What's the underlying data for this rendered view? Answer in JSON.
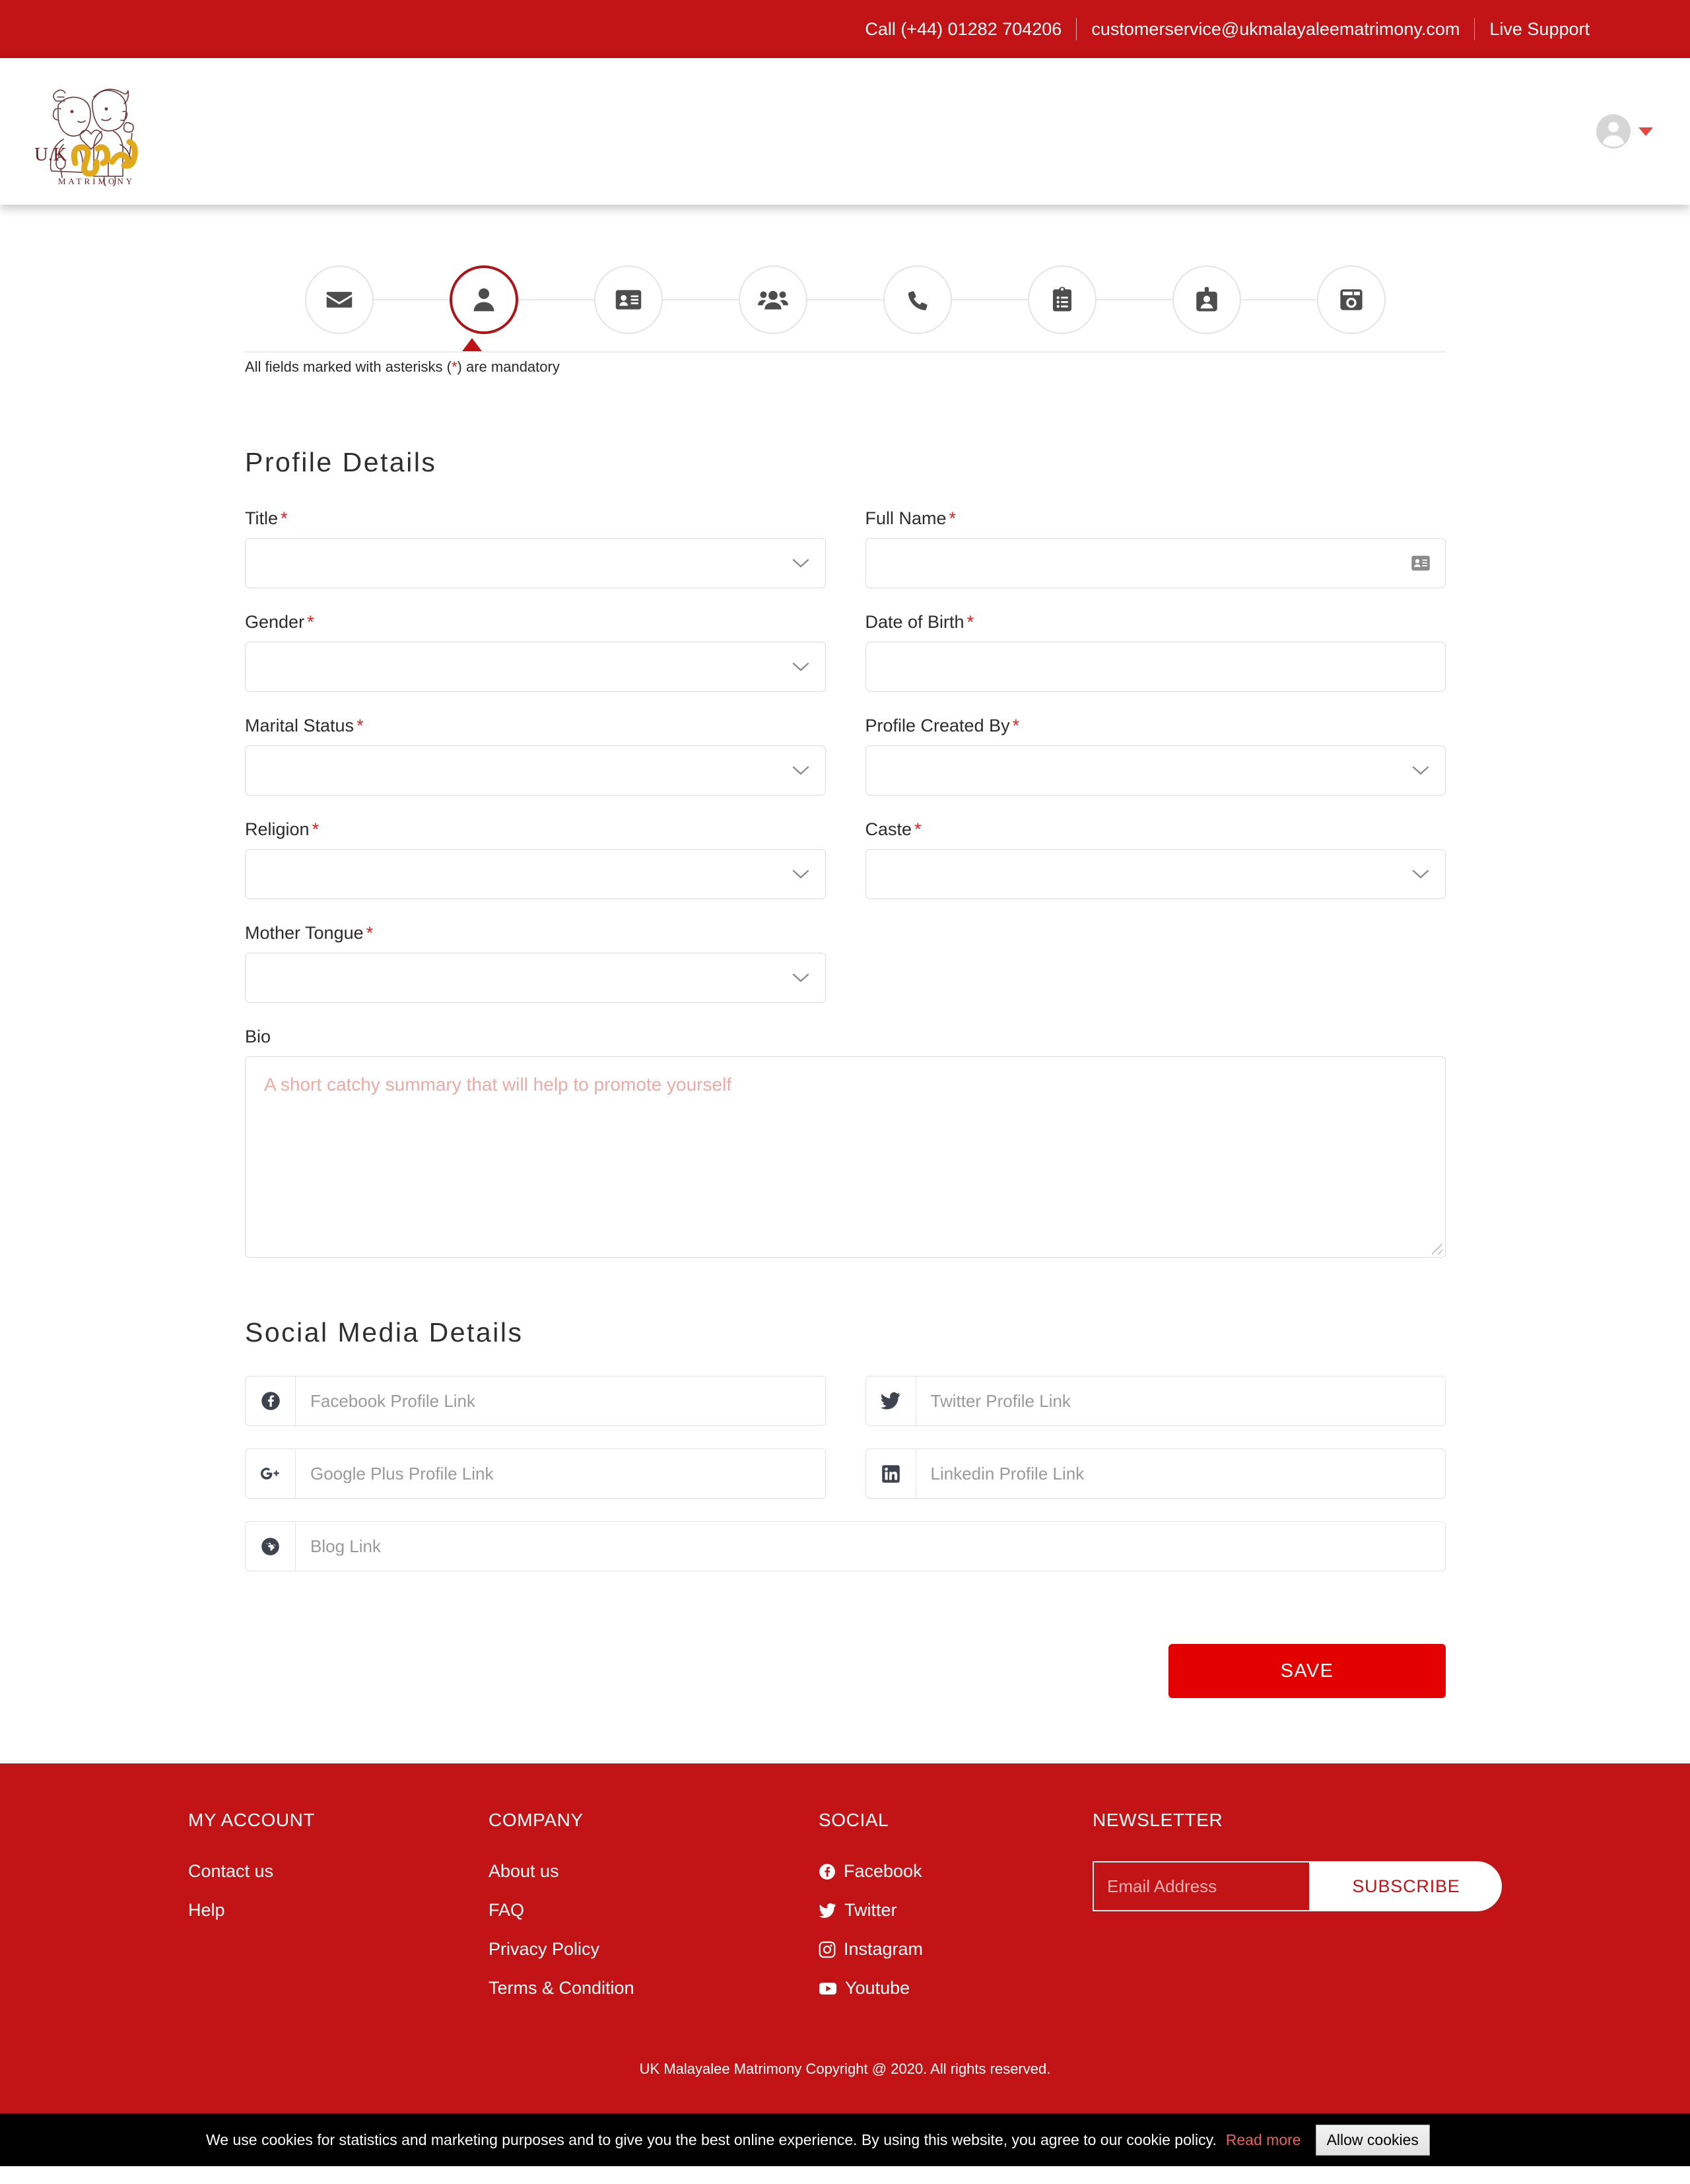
{
  "topbar": {
    "phone": "Call (+44) 01282 704206",
    "email": "customerservice@ukmalayaleematrimony.com",
    "support": "Live Support"
  },
  "header": {
    "logo_text_uk": "U.K",
    "logo_text_matrimony": "MATRIMONY",
    "account_icon": "user-avatar-icon",
    "caret_icon": "caret-down-icon"
  },
  "stepper": {
    "steps": [
      {
        "icon": "envelope-icon",
        "active": false
      },
      {
        "icon": "user-icon",
        "active": true
      },
      {
        "icon": "id-card-icon",
        "active": false
      },
      {
        "icon": "users-group-icon",
        "active": false
      },
      {
        "icon": "phone-icon",
        "active": false
      },
      {
        "icon": "clipboard-list-icon",
        "active": false
      },
      {
        "icon": "id-badge-icon",
        "active": false
      },
      {
        "icon": "camera-icon",
        "active": false
      }
    ],
    "note_before": "All fields marked with asterisks (",
    "note_asterisk": "*",
    "note_after": ") are mandatory"
  },
  "profile_section": {
    "title": "Profile Details",
    "fields": [
      {
        "label": "Title",
        "required": true,
        "type": "select",
        "value": "",
        "name": "title"
      },
      {
        "label": "Full Name",
        "required": true,
        "type": "text",
        "value": "",
        "placeholder": "",
        "name": "full-name",
        "trail_icon": "contact-card-icon"
      },
      {
        "label": "Gender",
        "required": true,
        "type": "select",
        "value": "",
        "name": "gender"
      },
      {
        "label": "Date of Birth",
        "required": true,
        "type": "text",
        "value": "",
        "placeholder": "",
        "name": "date-of-birth"
      },
      {
        "label": "Marital Status",
        "required": true,
        "type": "select",
        "value": "",
        "name": "marital-status"
      },
      {
        "label": "Profile Created By",
        "required": true,
        "type": "select",
        "value": "",
        "name": "profile-created-by"
      },
      {
        "label": "Religion",
        "required": true,
        "type": "select",
        "value": "",
        "name": "religion"
      },
      {
        "label": "Caste",
        "required": true,
        "type": "select",
        "value": "",
        "name": "caste"
      },
      {
        "label": "Mother Tongue",
        "required": true,
        "type": "select",
        "value": "",
        "name": "mother-tongue"
      }
    ],
    "bio": {
      "label": "Bio",
      "placeholder": "A short catchy summary that will help to promote yourself",
      "value": ""
    }
  },
  "social_section": {
    "title": "Social Media Details",
    "rows": [
      {
        "icon": "facebook-icon",
        "placeholder": "Facebook Profile Link",
        "value": "",
        "name": "facebook-link-input"
      },
      {
        "icon": "twitter-icon",
        "placeholder": "Twitter Profile Link",
        "value": "",
        "name": "twitter-link-input"
      },
      {
        "icon": "google-plus-icon",
        "placeholder": "Google Plus Profile Link",
        "value": "",
        "name": "google-plus-link-input"
      },
      {
        "icon": "linkedin-icon",
        "placeholder": "Linkedin Profile Link",
        "value": "",
        "name": "linkedin-link-input"
      },
      {
        "icon": "globe-icon",
        "placeholder": "Blog Link",
        "value": "",
        "name": "blog-link-input"
      }
    ]
  },
  "actions": {
    "save_label": "SAVE"
  },
  "footer": {
    "my_account": {
      "heading": "MY ACCOUNT",
      "links": [
        "Contact us",
        "Help"
      ]
    },
    "company": {
      "heading": "COMPANY",
      "links": [
        "About us",
        "FAQ",
        "Privacy Policy",
        "Terms & Condition"
      ]
    },
    "social": {
      "heading": "SOCIAL",
      "links": [
        {
          "label": "Facebook",
          "icon": "facebook-icon"
        },
        {
          "label": "Twitter",
          "icon": "twitter-icon"
        },
        {
          "label": "Instagram",
          "icon": "instagram-icon"
        },
        {
          "label": "Youtube",
          "icon": "youtube-icon"
        }
      ]
    },
    "newsletter": {
      "heading": "NEWSLETTER",
      "placeholder": "Email Address",
      "value": "",
      "button": "SUBSCRIBE"
    },
    "copyright": "UK Malayalee Matrimony Copyright @ 2020. All rights reserved."
  },
  "cookie_bar": {
    "text": "We use cookies for statistics and marketing purposes and to give you the best online experience. By using this website, you agree to our cookie policy.",
    "read_more": "Read more",
    "allow_button": "Allow cookies"
  },
  "colors": {
    "brand_red": "#c21316",
    "save_red": "#e30000",
    "active_step": "#b01217",
    "cookie_link": "#e8615e"
  }
}
